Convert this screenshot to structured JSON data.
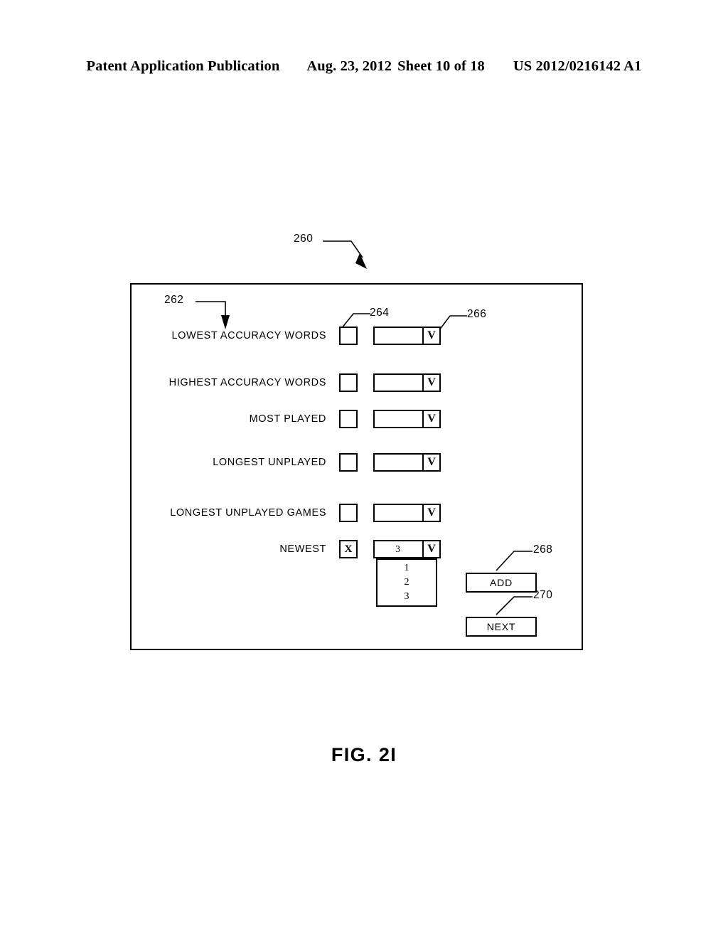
{
  "header": {
    "publication": "Patent Application Publication",
    "date": "Aug. 23, 2012",
    "sheet": "Sheet 10 of 18",
    "patent_number": "US 2012/0216142 A1"
  },
  "figure": {
    "caption": "FIG. 2I",
    "panel_ref": "260",
    "label_ref": "262",
    "checkbox_ref": "264",
    "dropdown_ref": "266",
    "add_ref": "268",
    "next_ref": "270"
  },
  "dialog": {
    "rows": [
      {
        "label": "LOWEST ACCURACY WORDS",
        "checked": false,
        "checkbox_mark": "",
        "value": "",
        "arrow": "V"
      },
      {
        "label": "HIGHEST ACCURACY WORDS",
        "checked": false,
        "checkbox_mark": "",
        "value": "",
        "arrow": "V"
      },
      {
        "label": "MOST PLAYED",
        "checked": false,
        "checkbox_mark": "",
        "value": "",
        "arrow": "V"
      },
      {
        "label": "LONGEST UNPLAYED",
        "checked": false,
        "checkbox_mark": "",
        "value": "",
        "arrow": "V"
      },
      {
        "label": "LONGEST UNPLAYED GAMES",
        "checked": false,
        "checkbox_mark": "",
        "value": "",
        "arrow": "V"
      },
      {
        "label": "NEWEST",
        "checked": true,
        "checkbox_mark": "X",
        "value": "3",
        "arrow": "V"
      }
    ],
    "open_dropdown": {
      "selected": "3",
      "options": [
        "1",
        "2",
        "3"
      ]
    },
    "buttons": {
      "add": "ADD",
      "next": "NEXT"
    }
  }
}
